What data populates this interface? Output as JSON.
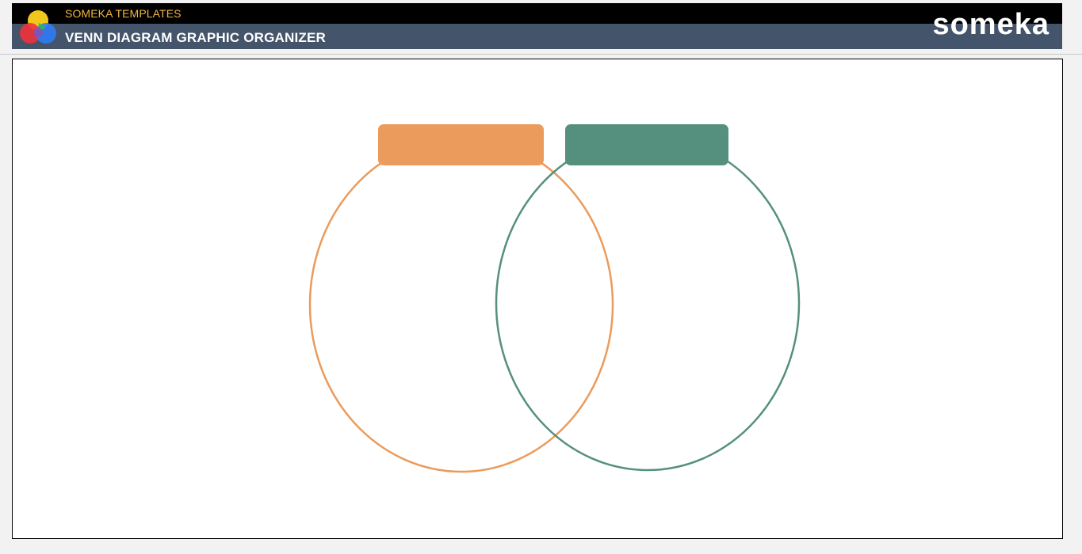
{
  "header": {
    "brand_line": "SOMEKA TEMPLATES",
    "title": "VENN DIAGRAM GRAPHIC ORGANIZER",
    "wordmark": "someka",
    "logo_icon": "color-circles-logo-icon"
  },
  "venn": {
    "set_a": {
      "label": "",
      "color": "#eb9b5c"
    },
    "set_b": {
      "label": "",
      "color": "#55907e"
    }
  }
}
